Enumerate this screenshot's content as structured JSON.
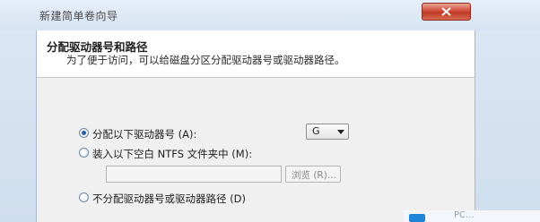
{
  "window": {
    "title": "新建简单卷向导"
  },
  "header": {
    "title": "分配驱动器号和路径",
    "description": "为了便于访问，可以给磁盘分区分配驱动器号或驱动器路径。"
  },
  "options": {
    "assign_letter": {
      "label": "分配以下驱动器号 (A):",
      "checked": true
    },
    "drive_letter_select": {
      "value": "G"
    },
    "mount_folder": {
      "label": "装入以下空白 NTFS 文件夹中 (M):",
      "checked": false
    },
    "folder_path": {
      "value": ""
    },
    "browse_button": {
      "label": "浏览 (R)..."
    },
    "no_assign": {
      "label": "不分配驱动器号或驱动器路径 (D)",
      "checked": false
    }
  },
  "watermark": {
    "text": "PC..."
  },
  "colors": {
    "titlebar": "#d6e3f2",
    "close_button": "#c03a28",
    "dialog_background": "#f0f0f0",
    "header_background": "#ffffff",
    "radio_selected": "#2a5fa8"
  }
}
